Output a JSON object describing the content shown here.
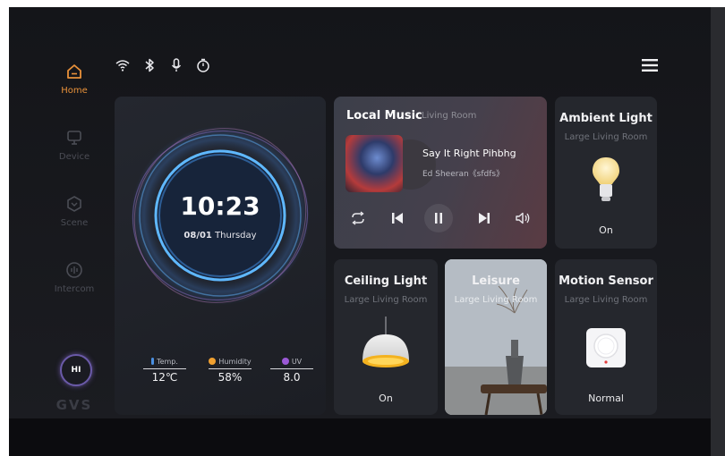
{
  "sidebar": {
    "items": [
      {
        "label": "Home",
        "icon": "home-icon",
        "active": true
      },
      {
        "label": "Device",
        "icon": "monitor-icon",
        "active": false
      },
      {
        "label": "Scene",
        "icon": "scene-icon",
        "active": false
      },
      {
        "label": "Intercom",
        "icon": "intercom-icon",
        "active": false
      }
    ],
    "badge": "HI",
    "logo": "GVS"
  },
  "status_bar": {
    "icons": [
      "wifi-icon",
      "bluetooth-icon",
      "microphone-icon",
      "timer-icon"
    ],
    "menu_icon": "hamburger-menu-icon"
  },
  "clock": {
    "time": "10:23",
    "date": "08/01",
    "weekday": "Thursday",
    "weather": [
      {
        "label": "Temp.",
        "value": "12℃",
        "icon": "thermometer-icon",
        "color": "#4a90e2"
      },
      {
        "label": "Humidity",
        "value": "58%",
        "icon": "humidity-icon",
        "color": "#f0a030"
      },
      {
        "label": "UV",
        "value": "8.0",
        "icon": "uv-icon",
        "color": "#9b59d6"
      }
    ]
  },
  "music": {
    "title": "Local Music",
    "room": "Living Room",
    "song": "Say It Right Pihbhg",
    "artist": "Ed Sheeran《sfdfs》"
  },
  "cards": {
    "ambient": {
      "title": "Ambient Light",
      "room": "Large Living Room",
      "state": "On"
    },
    "ceiling": {
      "title": "Ceiling Light",
      "room": "Large Living Room",
      "state": "On"
    },
    "leisure": {
      "title": "Leisure",
      "room": "Large Living Room"
    },
    "motion": {
      "title": "Motion Sensor",
      "room": "Large Living Room",
      "state": "Normal"
    }
  },
  "colors": {
    "accent": "#e9913a",
    "background": "#17181c",
    "card": "#25272d"
  }
}
